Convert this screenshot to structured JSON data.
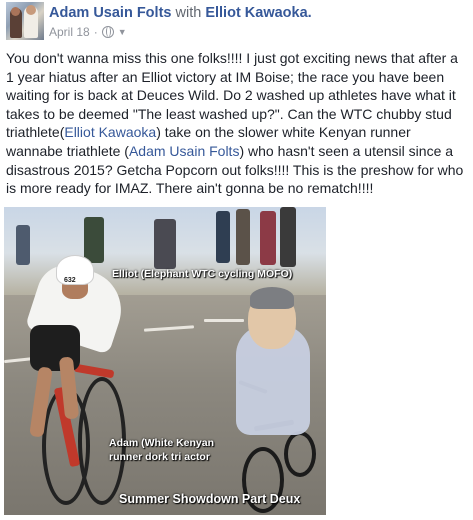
{
  "post": {
    "author": "Adam Usain Folts",
    "with_text": "with",
    "tagged": "Elliot Kawaoka.",
    "date": "April 18",
    "separator": "·",
    "privacy_icon": "globe-icon",
    "chevron_icon": "chevron-down-icon",
    "body": {
      "part1": "You don't wanna miss this one folks!!!! I just got exciting news that after a 1 year hiatus after an Elliot victory at IM Boise; the race you have been waiting for is back at Deuces Wild. Do 2 washed up athletes have what it takes to be deemed \"The least washed up?\". Can the WTC chubby stud triathlete(",
      "link1": "Elliot Kawaoka",
      "part2": ") take on the slower white Kenyan runner wannabe triathlete (",
      "link2": "Adam Usain Folts",
      "part3": ") who hasn't seen a utensil since a disastrous 2015? Getcha Popcorn out folks!!!! This is the preshow for who is more ready for IMAZ. There ain't gonna be no rematch!!!!"
    },
    "image": {
      "caption_elliot": "Elliot (Elephant WTC cycling MOFO)",
      "caption_adam": "Adam (White Kenyan runner dork tri actor",
      "caption_showdown": "Summer Showdown Part Deux",
      "rider_number": "632"
    },
    "colors": {
      "link": "#365899",
      "text": "#1d2129",
      "meta": "#90949c"
    }
  }
}
